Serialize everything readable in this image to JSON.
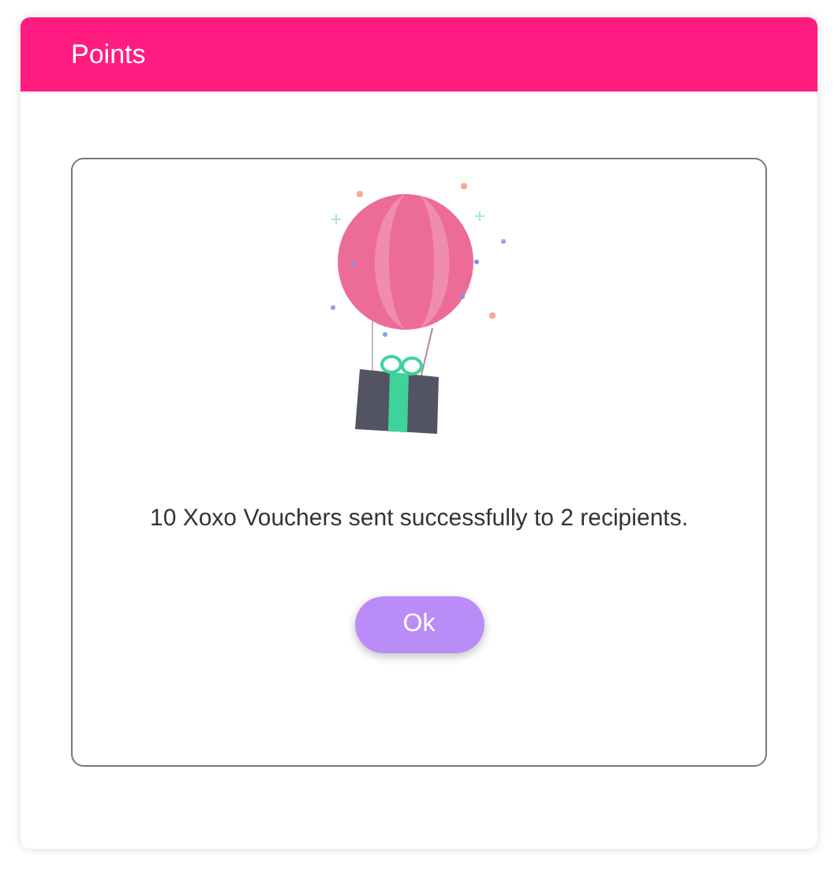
{
  "header": {
    "title": "Points"
  },
  "message": "10 Xoxo Vouchers sent successfully to 2 recipients.",
  "button": {
    "label": "Ok"
  }
}
